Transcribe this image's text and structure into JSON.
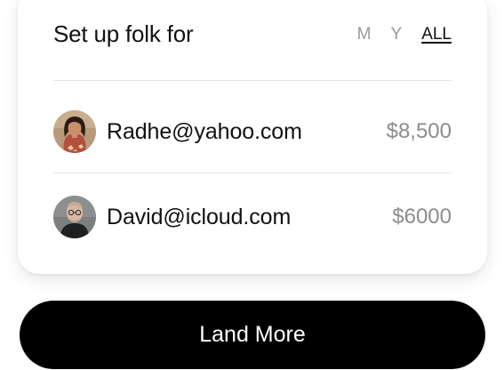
{
  "card": {
    "title": "Set up folk for",
    "period_tabs": [
      {
        "label": "M",
        "active": false
      },
      {
        "label": "Y",
        "active": false
      },
      {
        "label": "ALL",
        "active": true
      }
    ]
  },
  "users": [
    {
      "email": "Radhe@yahoo.com",
      "amount": "$8,500",
      "avatar": "woman-portrait"
    },
    {
      "email": "David@icloud.com",
      "amount": "$6000",
      "avatar": "man-portrait"
    }
  ],
  "cta": {
    "label": "Land More"
  },
  "colors": {
    "cta_background": "#000000",
    "cta_text": "#ffffff",
    "muted_text": "#8c8c8c",
    "divider": "#e3e3e3"
  }
}
